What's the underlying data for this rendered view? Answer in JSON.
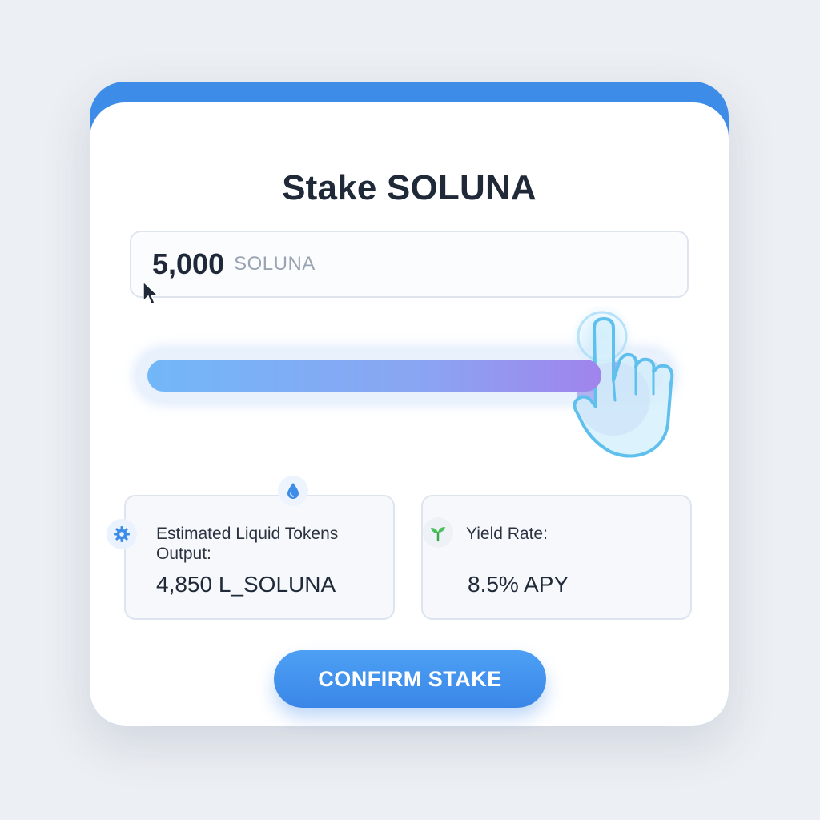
{
  "title": "Stake SOLUNA",
  "amount_input": {
    "value": "5,000",
    "unit": "SOLUNA"
  },
  "slider": {
    "fill_fraction": 0.88
  },
  "estimated_output": {
    "label": "Estimated Liquid Tokens Output:",
    "value": "4,850 L_SOLUNA",
    "icon": "gear-icon",
    "badge_icon": "droplet-icon"
  },
  "yield_rate": {
    "label": "Yield Rate:",
    "value": "8.5% APY",
    "icon": "sprout-icon"
  },
  "confirm_button": {
    "label": "CONFIRM STAKE"
  },
  "colors": {
    "accent": "#3d8de8",
    "gradient_start": "#72b7f8",
    "gradient_end": "#a084ec",
    "background": "#eceff3"
  }
}
